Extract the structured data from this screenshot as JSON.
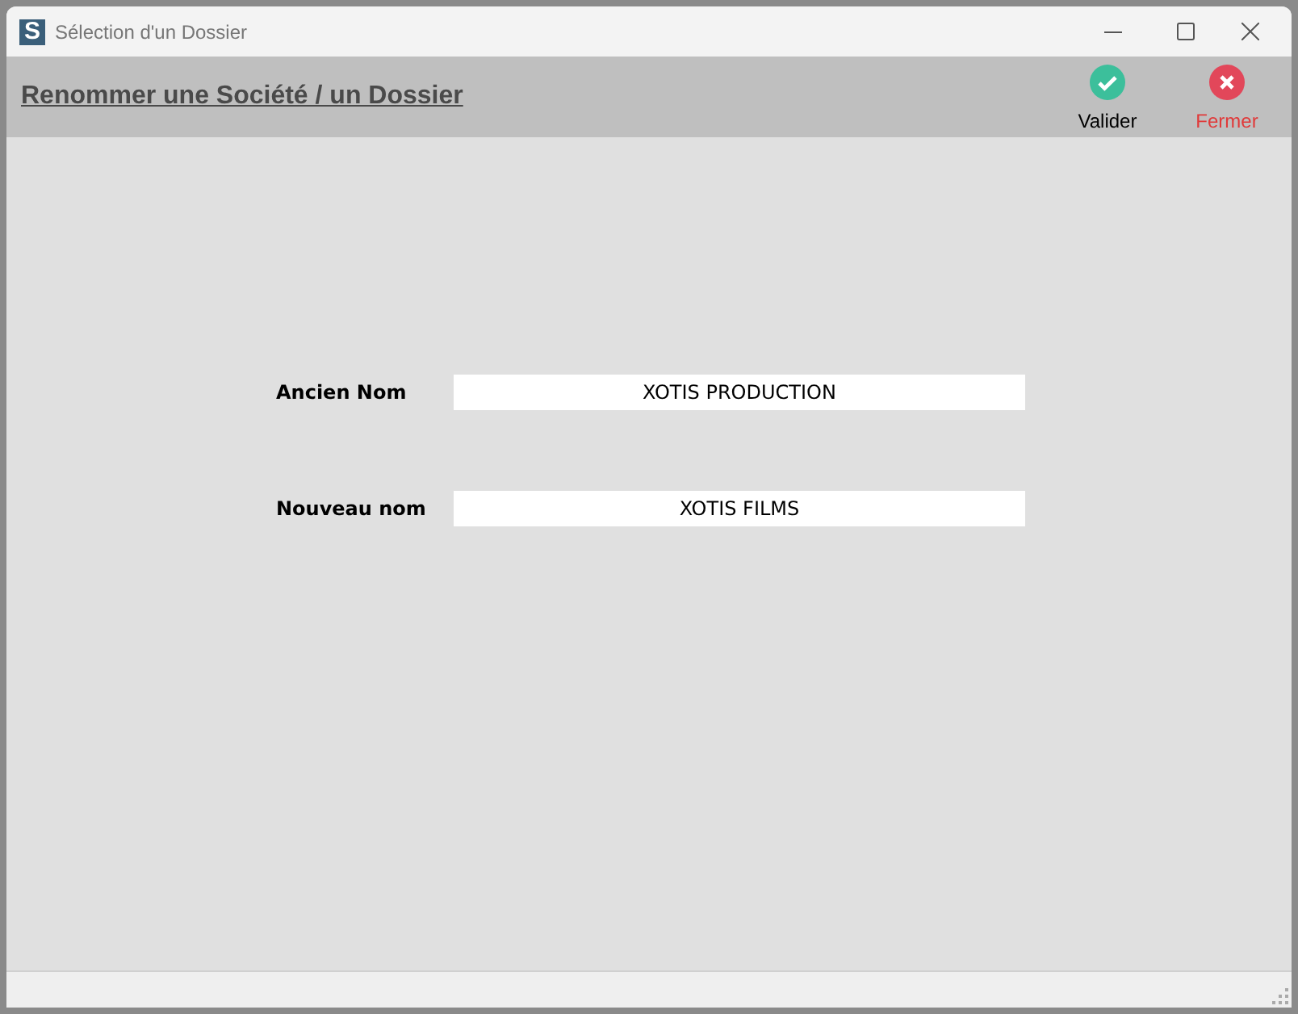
{
  "window": {
    "logo": "S",
    "title": "Sélection d'un Dossier"
  },
  "header": {
    "title": "Renommer une Société / un Dossier"
  },
  "actions": [
    {
      "kind": "validate",
      "label": "Valider"
    },
    {
      "kind": "close",
      "label": "Fermer"
    }
  ],
  "fields": [
    {
      "label": "Ancien Nom",
      "value": "XOTIS PRODUCTION"
    },
    {
      "label": "Nouveau nom",
      "value": "XOTIS FILMS"
    }
  ]
}
